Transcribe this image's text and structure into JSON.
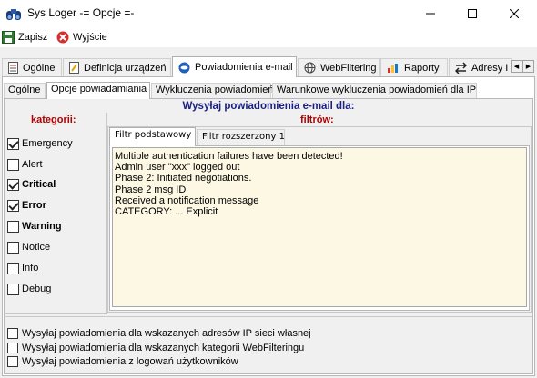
{
  "window": {
    "title": "Sys Loger -= Opcje =-",
    "icons": {
      "app": "binoculars-icon",
      "minimize": "minimize-icon",
      "maximize": "maximize-icon",
      "close": "close-icon"
    }
  },
  "toolbar": {
    "save_label": "Zapisz",
    "exit_label": "Wyjście"
  },
  "main_tabs": [
    {
      "label": "Ogólne",
      "icon": "document-icon"
    },
    {
      "label": "Definicja urządzeń",
      "icon": "edit-document-icon"
    },
    {
      "label": "Powiadomienia e-mail",
      "icon": "email-icon",
      "active": true
    },
    {
      "label": "WebFiltering",
      "icon": "globe-icon"
    },
    {
      "label": "Raporty",
      "icon": "report-icon"
    },
    {
      "label": "Adresy I",
      "icon": "arrows-icon"
    }
  ],
  "sub_tabs": [
    {
      "label": "Ogólne"
    },
    {
      "label": "Opcje powiadamiania",
      "active": true
    },
    {
      "label": "Wykluczenia powiadomień"
    },
    {
      "label": "Warunkowe wykluczenia powiadomień dla IP"
    }
  ],
  "heading": "Wysyłaj powiadomienia e-mail dla:",
  "categories_title": "kategorii:",
  "filters_title": "filtrów:",
  "categories": [
    {
      "label": "Emergency",
      "checked": true,
      "bold": false
    },
    {
      "label": "Alert",
      "checked": false,
      "bold": false
    },
    {
      "label": "Critical",
      "checked": true,
      "bold": true
    },
    {
      "label": "Error",
      "checked": true,
      "bold": true
    },
    {
      "label": "Warning",
      "checked": false,
      "bold": true
    },
    {
      "label": "Notice",
      "checked": false,
      "bold": false
    },
    {
      "label": "Info",
      "checked": false,
      "bold": false
    },
    {
      "label": "Debug",
      "checked": false,
      "bold": false
    }
  ],
  "filter_tabs": [
    {
      "label": "Filtr podstawowy",
      "active": true
    },
    {
      "label": "Filtr rozszerzony 1"
    }
  ],
  "filter_text": "Multiple authentication failures have been detected!\nAdmin user \"xxx\" logged out\nPhase 2: Initiated negotiations.\nPhase 2 msg ID\nReceived a notification message\nCATEGORY: ... Explicit",
  "options": [
    {
      "label": "Wysyłaj powiadomienia dla wskazanych adresów IP sieci własnej",
      "checked": false
    },
    {
      "label": "Wysyłaj powiadomienia dla wskazanych kategorii WebFilteringu",
      "checked": false
    },
    {
      "label": "Wysyłaj powiadomienia z logowań użytkowników",
      "checked": false
    }
  ],
  "colors": {
    "heading": "#1a1f80",
    "section_title": "#b00000",
    "filter_bg": "#fdf8e4"
  }
}
